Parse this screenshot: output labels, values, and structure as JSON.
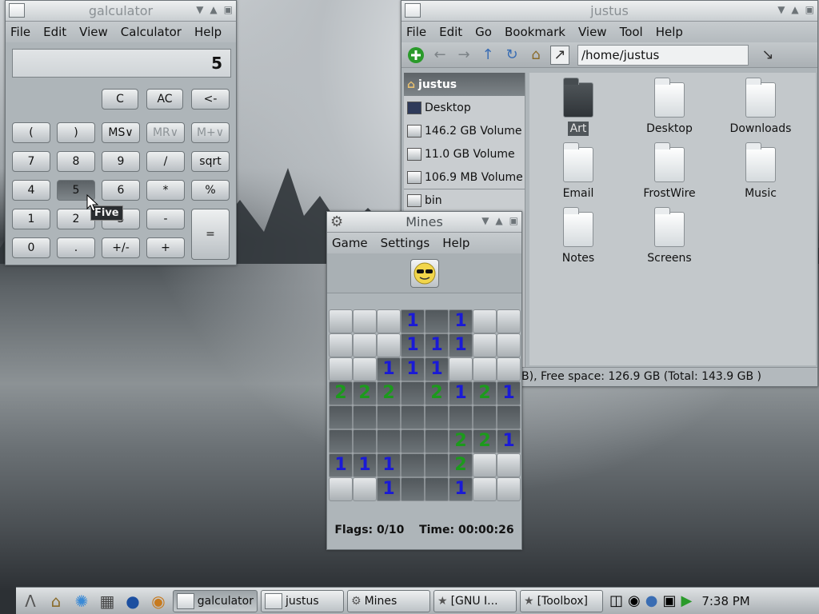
{
  "calculator": {
    "title": "galculator",
    "menu": [
      "File",
      "Edit",
      "View",
      "Calculator",
      "Help"
    ],
    "display": "5",
    "tooltip": "Five",
    "buttons": {
      "c": "C",
      "ac": "AC",
      "back": "<-",
      "lparen": "(",
      "rparen": ")",
      "ms": "MS∨",
      "mr": "MR∨",
      "mplus": "M+∨",
      "b7": "7",
      "b8": "8",
      "b9": "9",
      "div": "/",
      "sqrt": "sqrt",
      "b4": "4",
      "b5": "5",
      "b6": "6",
      "mul": "*",
      "pct": "%",
      "b1": "1",
      "b2": "2",
      "b3": "3",
      "minus": "-",
      "b0": "0",
      "dot": ".",
      "pm": "+/-",
      "plus": "+",
      "eq": "="
    }
  },
  "filemanager": {
    "title": "justus",
    "menu": [
      "File",
      "Edit",
      "Go",
      "Bookmark",
      "View",
      "Tool",
      "Help"
    ],
    "path": "/home/justus",
    "side": [
      "justus",
      "Desktop",
      "146.2 GB Volume",
      "11.0 GB Volume",
      "106.9 MB Volume",
      "bin"
    ],
    "items": [
      "Art",
      "Desktop",
      "Downloads",
      "Email",
      "FrostWire",
      "Music",
      "Notes",
      "Screens"
    ],
    "status": "B), Free space: 126.9 GB (Total: 143.9 GB )"
  },
  "mines": {
    "title": "Mines",
    "menu": [
      "Game",
      "Settings",
      "Help"
    ],
    "grid": [
      [
        "c",
        "c",
        "c",
        "1",
        "o",
        "1",
        "c",
        "c"
      ],
      [
        "c",
        "c",
        "c",
        "1",
        "1",
        "1",
        "c",
        "c"
      ],
      [
        "c",
        "c",
        "1",
        "1",
        "1",
        "c",
        "c",
        "c"
      ],
      [
        "2",
        "2",
        "2",
        "o",
        "2",
        "1",
        "2",
        "1"
      ],
      [
        "o",
        "o",
        "o",
        "o",
        "o",
        "o",
        "o",
        "o"
      ],
      [
        "o",
        "o",
        "o",
        "o",
        "o",
        "2",
        "2",
        "1"
      ],
      [
        "1",
        "1",
        "1",
        "o",
        "o",
        "2",
        "c",
        "c"
      ],
      [
        "c",
        "c",
        "1",
        "o",
        "o",
        "1",
        "c",
        "c"
      ]
    ],
    "flags": "Flags: 0/10",
    "time": "Time: 00:00:26"
  },
  "taskbar": {
    "tasks": [
      "galculator",
      "justus",
      "Mines",
      "[GNU I...",
      "[Toolbox]"
    ],
    "clock": "7:38 PM"
  }
}
